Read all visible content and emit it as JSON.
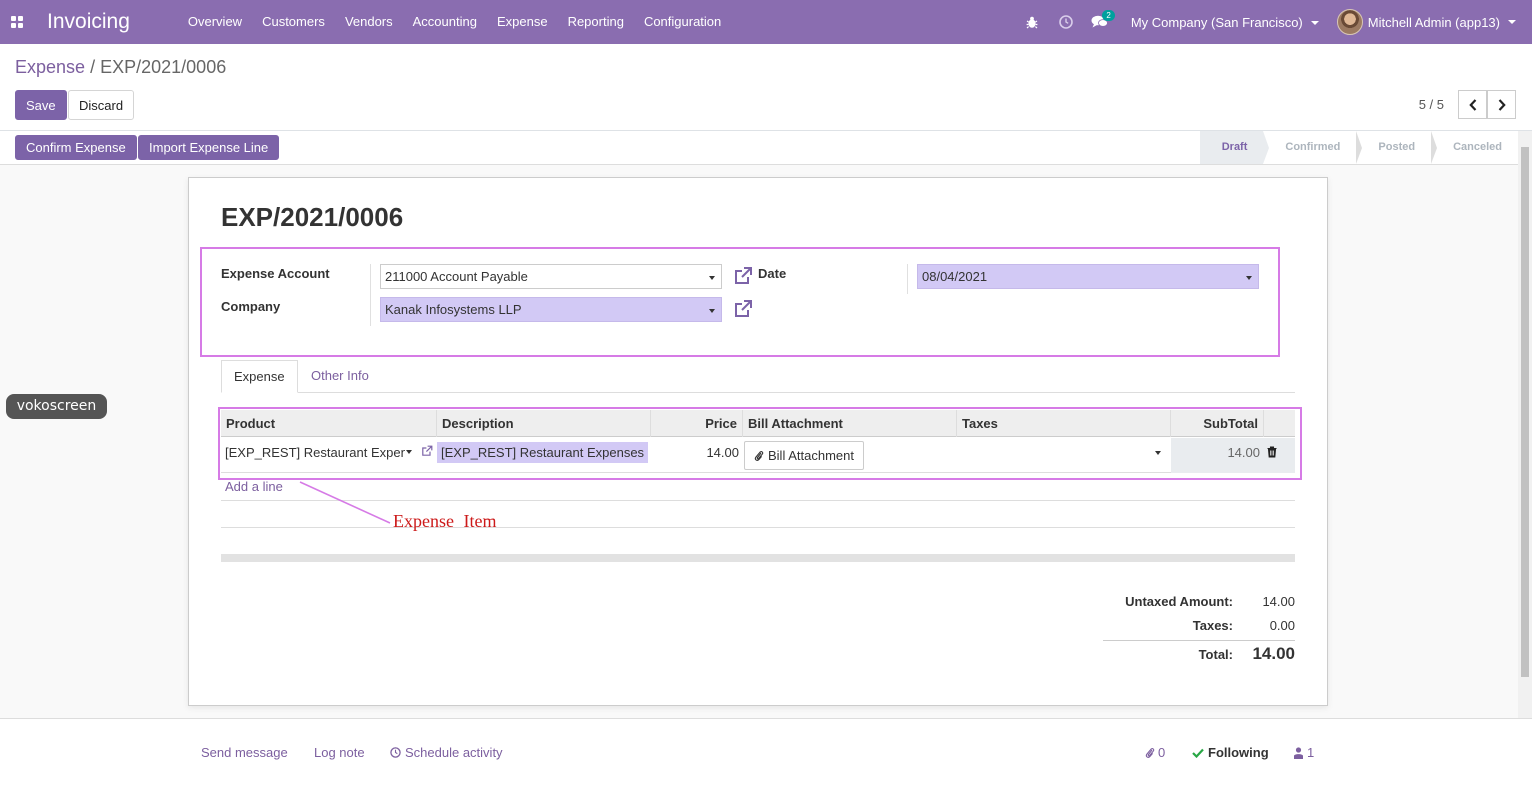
{
  "app": {
    "name": "Invoicing",
    "menus": [
      "Overview",
      "Customers",
      "Vendors",
      "Accounting",
      "Expense",
      "Reporting",
      "Configuration"
    ],
    "messages_badge": "2",
    "company": "My Company (San Francisco)",
    "user": "Mitchell Admin (app13)",
    "colors": {
      "navbar": "#8a6db0",
      "primary": "#7c63a8",
      "required_field": "#d2c9f5",
      "annotation": "#d67be6"
    }
  },
  "breadcrumb": {
    "parent": "Expense",
    "separator": "/",
    "current": "EXP/2021/0006"
  },
  "toolbar": {
    "save_label": "Save",
    "discard_label": "Discard",
    "pager": "5 / 5"
  },
  "actions": {
    "confirm_label": "Confirm Expense",
    "import_label": "Import Expense Line"
  },
  "stages": [
    "Draft",
    "Confirmed",
    "Posted",
    "Canceled"
  ],
  "record": {
    "title": "EXP/2021/0006",
    "expense_account_label": "Expense Account",
    "expense_account": "211000 Account Payable",
    "company_label": "Company",
    "company": "Kanak Infosystems LLP",
    "date_label": "Date",
    "date": "08/04/2021"
  },
  "tabs": [
    "Expense",
    "Other Info"
  ],
  "table": {
    "headers": [
      "Product",
      "Description",
      "Price",
      "Bill Attachment",
      "Taxes",
      "SubTotal"
    ],
    "row": {
      "product": "[EXP_REST] Restaurant Expenses",
      "description": "[EXP_REST] Restaurant Expenses",
      "price": "14.00",
      "bill_attachment": "Bill Attachment",
      "taxes": "",
      "subtotal": "14.00"
    },
    "add_line": "Add a line"
  },
  "totals": {
    "untaxed_label": "Untaxed Amount:",
    "untaxed": "14.00",
    "taxes_label": "Taxes:",
    "taxes": "0.00",
    "total_label": "Total:",
    "total": "14.00"
  },
  "annotation": {
    "text": "Expense Item"
  },
  "overlay": {
    "vokoscreen": "vokoscreen"
  },
  "chatter": {
    "send_message": "Send message",
    "log_note": "Log note",
    "schedule_activity": "Schedule activity",
    "attachments": "0",
    "following": "Following",
    "followers": "1"
  }
}
